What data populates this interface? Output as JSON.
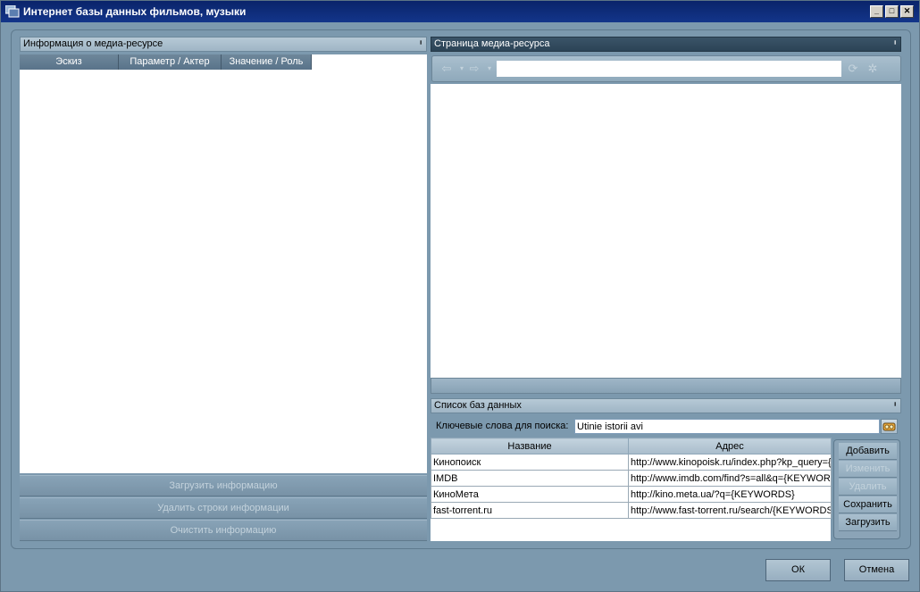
{
  "window": {
    "title": "Интернет базы данных фильмов, музыки",
    "controls": [
      "_",
      "□",
      "✕"
    ]
  },
  "left_panel": {
    "title": "Информация о медиа-ресурсе",
    "pin": "▫",
    "columns": [
      "Эскиз",
      "Параметр / Актер",
      "Значение / Роль"
    ],
    "buttons": {
      "load": "Загрузить информацию",
      "delete_rows": "Удалить строки информации",
      "clear": "Очистить информацию"
    }
  },
  "right_panel": {
    "title": "Страница медиа-ресурса",
    "pin": "▫",
    "url": ""
  },
  "db_panel": {
    "title": "Список баз данных",
    "pin": "▫",
    "search_label": "Ключевые слова для поиска:",
    "keywords": "Utinie istorii avi",
    "columns": [
      "Название",
      "Адрес"
    ],
    "rows": [
      {
        "name": "Кинопоиск",
        "url": "http://www.kinopoisk.ru/index.php?kp_query={KEYWORDS}"
      },
      {
        "name": "IMDB",
        "url": "http://www.imdb.com/find?s=all&q={KEYWORDS}"
      },
      {
        "name": "КиноМета",
        "url": "http://kino.meta.ua/?q={KEYWORDS}"
      },
      {
        "name": "fast-torrent.ru",
        "url": "http://www.fast-torrent.ru/search/{KEYWORDS}"
      }
    ],
    "side_buttons": {
      "add": "Добавить",
      "edit": "Изменить",
      "delete": "Удалить",
      "save": "Сохранить",
      "load": "Загрузить"
    }
  },
  "dialog": {
    "ok": "ОК",
    "cancel": "Отмена"
  },
  "colors": {
    "titlebar": "#0a246a",
    "background": "#7c99ae",
    "dark_header": "#2c4356"
  }
}
